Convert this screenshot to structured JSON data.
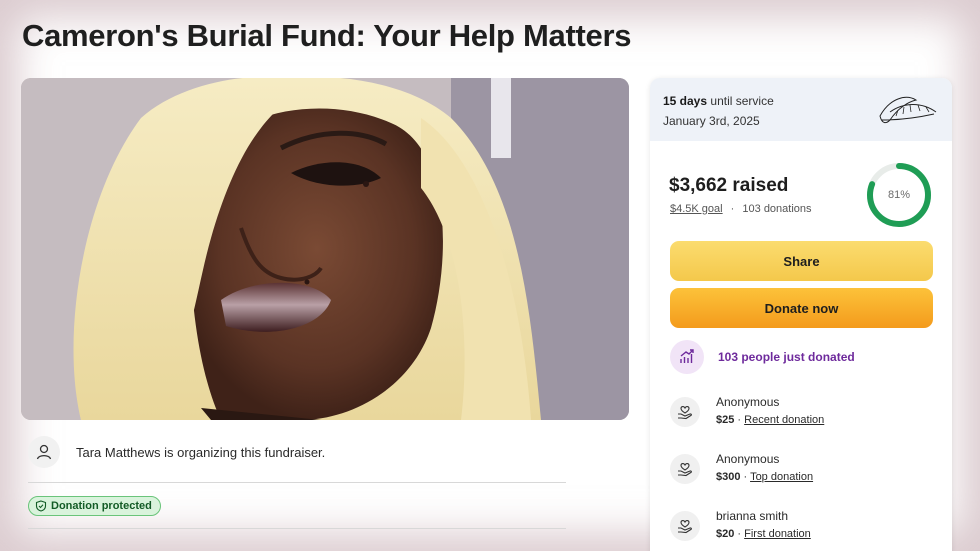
{
  "page": {
    "title": "Cameron's Burial Fund: Your Help Matters"
  },
  "organizer": {
    "text": "Tara Matthews is organizing this fundraiser.",
    "icon": "user-icon"
  },
  "badge": {
    "label": "Donation protected",
    "icon": "shield-check-icon",
    "color": "#d9f3dc"
  },
  "service": {
    "days": "15 days",
    "days_suffix": "until service",
    "date": "January 3rd, 2025",
    "icon": "leaf-icon"
  },
  "progress": {
    "raised": "$3,662 raised",
    "goal": "$4.5K goal",
    "separator": "·",
    "donations": "103 donations",
    "percent_label": "81%",
    "percent": 0.81,
    "ring_color": "#1f9d55"
  },
  "buttons": {
    "share": "Share",
    "donate": "Donate now"
  },
  "activity": {
    "text": "103 people just donated",
    "icon": "trending-up-icon",
    "color": "#6e2a9c"
  },
  "donors": [
    {
      "name": "Anonymous",
      "amount": "$25",
      "tag": "Recent donation",
      "icon": "heart-hand-icon"
    },
    {
      "name": "Anonymous",
      "amount": "$300",
      "tag": "Top donation",
      "icon": "heart-hand-icon"
    },
    {
      "name": "brianna smith",
      "amount": "$20",
      "tag": "First donation",
      "icon": "heart-hand-icon"
    }
  ]
}
